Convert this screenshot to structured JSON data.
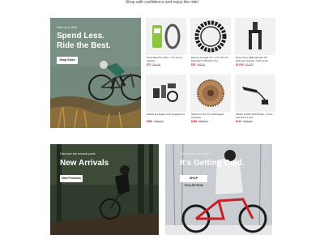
{
  "tagline": "Shop with confidence and enjoy the ride!",
  "hero": {
    "small": "Save up to 50%",
    "title_line1": "Spend Less.",
    "title_line2": "Ride the Best.",
    "button": "Shop Sales"
  },
  "products": [
    {
      "name": "Scotchfast Pro (EU) - Tire Insert (Single)",
      "sale": "$75",
      "was": "$94.99",
      "icon": "tire-insert-icon"
    },
    {
      "name": "Maxxis Assegai 29\" x 2.6\" WT 3C MaxxTerra TR EXO Tire",
      "sale": "$35",
      "was": "$95.00",
      "icon": "mtb-tire-icon"
    },
    {
      "name": "Rock Shox ZEB Ultimate 29\" Ultimate Charger 3 RC2 Fork",
      "sale": "$1,099",
      "was": "$1,459",
      "icon": "suspension-fork-icon"
    },
    {
      "name": "SRAM GX Eagle AXS Upgrade Kit",
      "sale": "$369",
      "was": "$549.00",
      "icon": "drivetrain-kit-icon"
    },
    {
      "name": "SRAM XX SL XG-1299 Eagle Cassette",
      "sale": "$488",
      "was": "$650.00",
      "icon": "cassette-icon"
    },
    {
      "name": "SRAM CODE RSC Brake - Front / Left Hand Lever",
      "sale": "$149",
      "was": "$230.00",
      "icon": "brake-lever-icon"
    }
  ],
  "banner_left": {
    "small": "Discover the newest parts",
    "title": "New Arrivals",
    "button": "New Products"
  },
  "banner_right": {
    "small": "Fall gear is here now",
    "title": "It's Getting Cold.",
    "button": "SHOP COLLECTION"
  },
  "colors": {
    "sale": "#d32424",
    "hero_bg": "#6e8378",
    "forest_bg": "#2f3b2c",
    "snow_bg": "#c9cdd2"
  }
}
